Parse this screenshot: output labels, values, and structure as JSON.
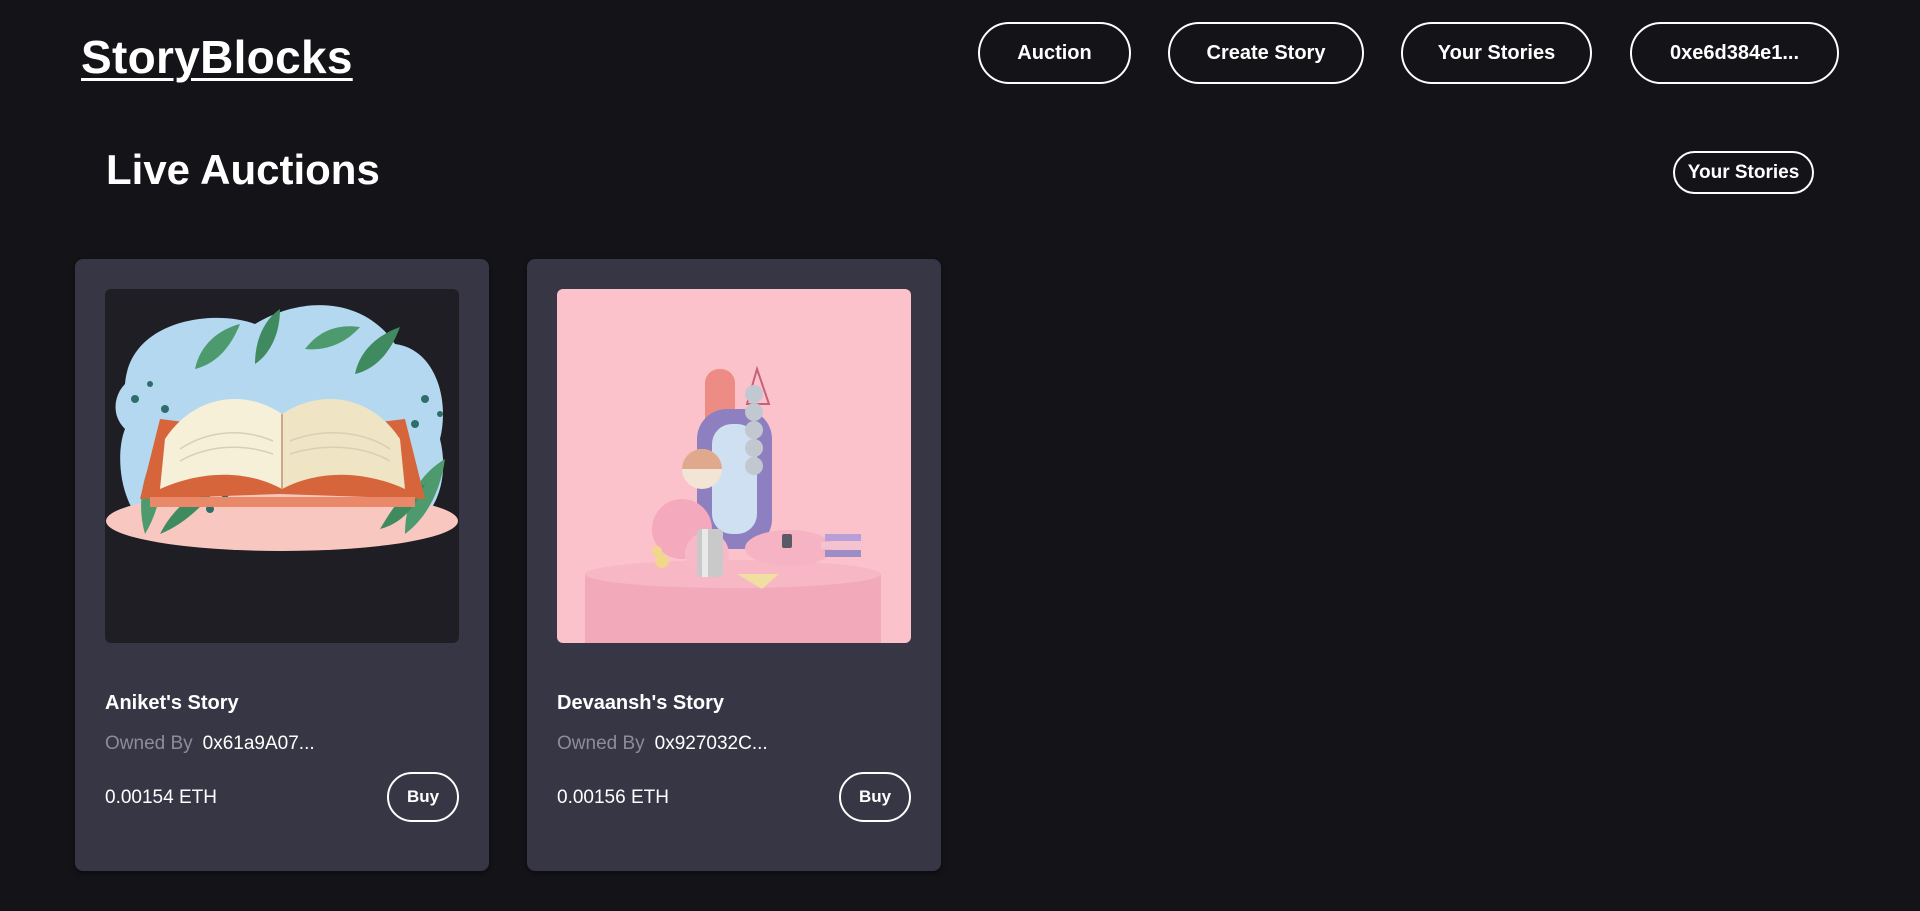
{
  "brand": {
    "name": "StoryBlocks"
  },
  "nav": {
    "auction": "Auction",
    "create_story": "Create Story",
    "your_stories": "Your Stories",
    "wallet": "0xe6d384e1..."
  },
  "section": {
    "title": "Live Auctions",
    "button": "Your Stories"
  },
  "cards": [
    {
      "title": "Aniket's Story",
      "owner_label": "Owned By",
      "owner": "0x61a9A07...",
      "price": "0.00154 ETH",
      "buy_label": "Buy",
      "image": "open-book-illustration"
    },
    {
      "title": "Devaansh's Story",
      "owner_label": "Owned By",
      "owner": "0x927032C...",
      "price": "0.00156 ETH",
      "buy_label": "Buy",
      "image": "pink-3d-abstract-render"
    }
  ],
  "colors": {
    "background": "#131318",
    "card": "#373645",
    "muted_text": "#8d8c99",
    "accent_pink": "#fbc2cc"
  }
}
